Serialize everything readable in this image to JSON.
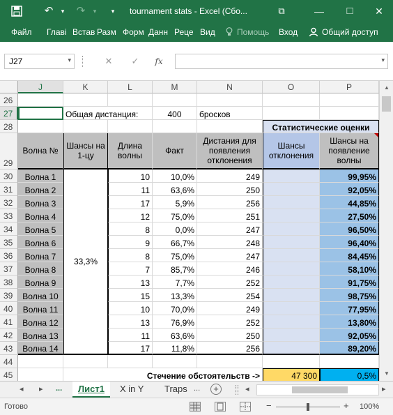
{
  "window": {
    "title": "tournament stats - Excel (Сбо...",
    "save_icon": "💾",
    "undo_icon": "↶",
    "redo_icon": "↷",
    "dropdown_icon": "▾",
    "restore_icon": "⧉",
    "minimize_icon": "—",
    "maximize_icon": "□",
    "close_icon": "✕"
  },
  "ribbon": {
    "tabs": [
      "Файл",
      "Главі",
      "Встав",
      "Разм",
      "Форм",
      "Данн",
      "Реце",
      "Вид"
    ],
    "help": "Помощь",
    "login": "Вход",
    "share": "Общий доступ"
  },
  "formula_bar": {
    "name_box": "J27",
    "cancel_icon": "✕",
    "enter_icon": "✓",
    "fx": "fx",
    "value": ""
  },
  "sheet": {
    "columns": [
      "J",
      "K",
      "L",
      "M",
      "N",
      "O",
      "P"
    ],
    "rows": [
      "26",
      "27",
      "28",
      "29",
      "30",
      "31",
      "32",
      "33",
      "34",
      "35",
      "36",
      "37",
      "38",
      "39",
      "40",
      "41",
      "42",
      "43",
      "44",
      "45"
    ],
    "r27": {
      "label": "Общая дистанция:",
      "value": "400",
      "unit": "бросков"
    },
    "stat_header": "Статистические оценки",
    "headers": {
      "wave": "Волна №",
      "chance": "Шансы на 1-цу",
      "length": "Длина волны",
      "fact": "Факт",
      "distance": "Дистания для появления отклонения",
      "deviation": "Шансы отклонения",
      "appearance": "Шансы на появление волны"
    },
    "chance_merged": "33,3%",
    "data": [
      {
        "wave": "Волна 1",
        "length": "10",
        "fact": "10,0%",
        "dist": "249",
        "p": "99,95%"
      },
      {
        "wave": "Волна 2",
        "length": "11",
        "fact": "63,6%",
        "dist": "250",
        "p": "92,05%"
      },
      {
        "wave": "Волна 3",
        "length": "17",
        "fact": "5,9%",
        "dist": "256",
        "p": "44,85%"
      },
      {
        "wave": "Волна 4",
        "length": "12",
        "fact": "75,0%",
        "dist": "251",
        "p": "27,50%"
      },
      {
        "wave": "Волна 5",
        "length": "8",
        "fact": "0,0%",
        "dist": "247",
        "p": "96,50%"
      },
      {
        "wave": "Волна 6",
        "length": "9",
        "fact": "66,7%",
        "dist": "248",
        "p": "96,40%"
      },
      {
        "wave": "Волна 7",
        "length": "8",
        "fact": "75,0%",
        "dist": "247",
        "p": "84,45%"
      },
      {
        "wave": "Волна 8",
        "length": "7",
        "fact": "85,7%",
        "dist": "246",
        "p": "58,10%"
      },
      {
        "wave": "Волна 9",
        "length": "13",
        "fact": "7,7%",
        "dist": "252",
        "p": "91,75%"
      },
      {
        "wave": "Волна 10",
        "length": "15",
        "fact": "13,3%",
        "dist": "254",
        "p": "98,75%"
      },
      {
        "wave": "Волна 11",
        "length": "10",
        "fact": "70,0%",
        "dist": "249",
        "p": "77,95%"
      },
      {
        "wave": "Волна 12",
        "length": "13",
        "fact": "76,9%",
        "dist": "252",
        "p": "13,80%"
      },
      {
        "wave": "Волна 13",
        "length": "11",
        "fact": "63,6%",
        "dist": "250",
        "p": "92,05%"
      },
      {
        "wave": "Волна 14",
        "length": "17",
        "fact": "11,8%",
        "dist": "256",
        "p": "89,20%"
      }
    ],
    "r45": {
      "label": "Стечение обстоятельств ->",
      "o_value": "47 300",
      "p_value": "0,5%"
    }
  },
  "sheet_tabs": {
    "prev_icon": "◂",
    "next_icon": "▸",
    "ellipsis": "...",
    "tabs": [
      "Лист1",
      "X in Y",
      "Traps"
    ],
    "ellipsis2": "...",
    "add_icon": "+",
    "scroll_left_icon": "◂",
    "scroll_right_icon": "▸"
  },
  "status": {
    "ready": "Готово",
    "zoom_minus": "−",
    "zoom_plus": "+",
    "zoom": "100%"
  }
}
